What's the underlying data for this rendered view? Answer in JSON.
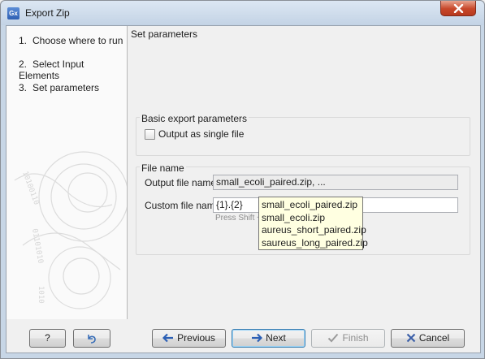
{
  "window": {
    "title": "Export Zip",
    "app_icon_text": "Gx"
  },
  "steps": [
    {
      "num": "1.",
      "label": "Choose where to run"
    },
    {
      "num": "2.",
      "label": "Select Input Elements"
    },
    {
      "num": "3.",
      "label": "Set parameters"
    }
  ],
  "content": {
    "title": "Set parameters",
    "basic_group": {
      "label": "Basic export parameters",
      "single_file_label": "Output as single file",
      "single_file_checked": false
    },
    "file_group": {
      "label": "File name",
      "output_label": "Output file name",
      "output_value": "small_ecoli_paired.zip, ...",
      "custom_label": "Custom file name",
      "custom_value": "{1}.{2}",
      "hint": "Press Shift + F1"
    },
    "popup_items": [
      "small_ecoli_paired.zip",
      "small_ecoli.zip",
      "aureus_short_paired.zip",
      "saureus_long_paired.zip"
    ]
  },
  "buttons": {
    "help": "?",
    "previous": "Previous",
    "next": "Next",
    "finish": "Finish",
    "cancel": "Cancel"
  },
  "colors": {
    "arrow_blue": "#2b5fb5",
    "cancel_x": "#3b5fa8",
    "finish_check": "#9a9a9a"
  }
}
